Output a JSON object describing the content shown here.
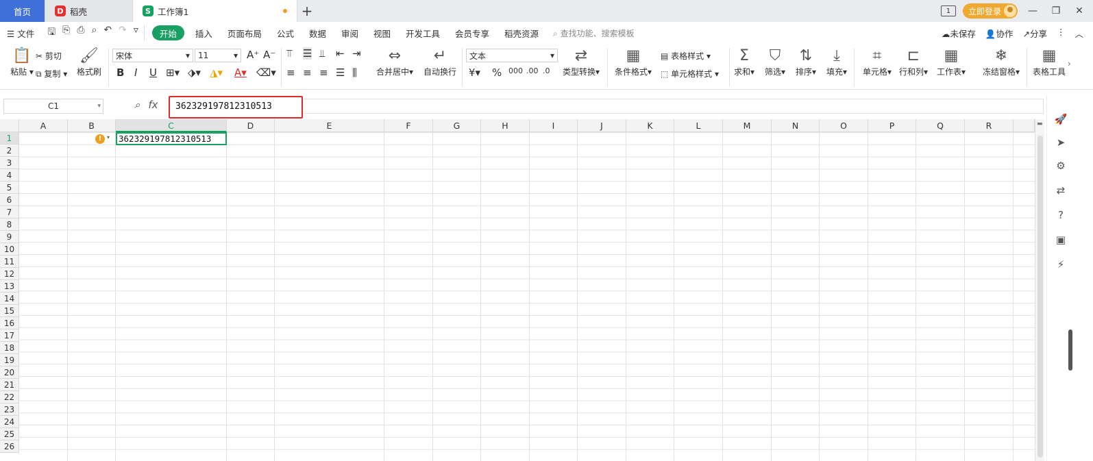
{
  "tabs": {
    "home": "首页",
    "docer": "稻壳",
    "workbook": "工作簿1",
    "new_tab": "+"
  },
  "titlebar": {
    "login": "立即登录",
    "layout_icon": "1"
  },
  "menu": {
    "file": "文件",
    "items": [
      "开始",
      "插入",
      "页面布局",
      "公式",
      "数据",
      "审阅",
      "视图",
      "开发工具",
      "会员专享",
      "稻壳资源"
    ],
    "search": "查找功能、搜索模板",
    "unsaved": "未保存",
    "collab": "协作",
    "share": "分享"
  },
  "ribbon": {
    "paste": "粘贴",
    "cut": "剪切",
    "copy": "复制",
    "format_painter": "格式刷",
    "font": "宋体",
    "size": "11",
    "merge": "合并居中",
    "wrap": "自动换行",
    "number_format": "文本",
    "type_convert": "类型转换",
    "cond_format": "条件格式",
    "table_style": "表格样式",
    "cell_style": "单元格样式",
    "sum": "求和",
    "filter": "筛选",
    "sort": "排序",
    "fill": "填充",
    "cell": "单元格",
    "row_col": "行和列",
    "worksheet": "工作表",
    "freeze": "冻结窗格",
    "table_tools": "表格工具"
  },
  "formula_bar": {
    "cell_ref": "C1",
    "value": "362329197812310513"
  },
  "sheet": {
    "columns": [
      "A",
      "B",
      "C",
      "D",
      "E",
      "F",
      "G",
      "H",
      "I",
      "J",
      "K",
      "L",
      "M",
      "N",
      "O",
      "P",
      "Q",
      "R"
    ],
    "rows": [
      "1",
      "2",
      "3",
      "4",
      "5",
      "6",
      "7",
      "8",
      "9",
      "10",
      "11",
      "12",
      "13",
      "14",
      "15",
      "16",
      "17",
      "18",
      "19",
      "20",
      "21",
      "22",
      "23",
      "24",
      "25",
      "26"
    ],
    "active_cell_value": "362329197812310513"
  },
  "colors": {
    "accent": "#19a063",
    "highlight": "#e02a2a",
    "home_tab": "#3f6fd8",
    "login": "#f0a830"
  }
}
